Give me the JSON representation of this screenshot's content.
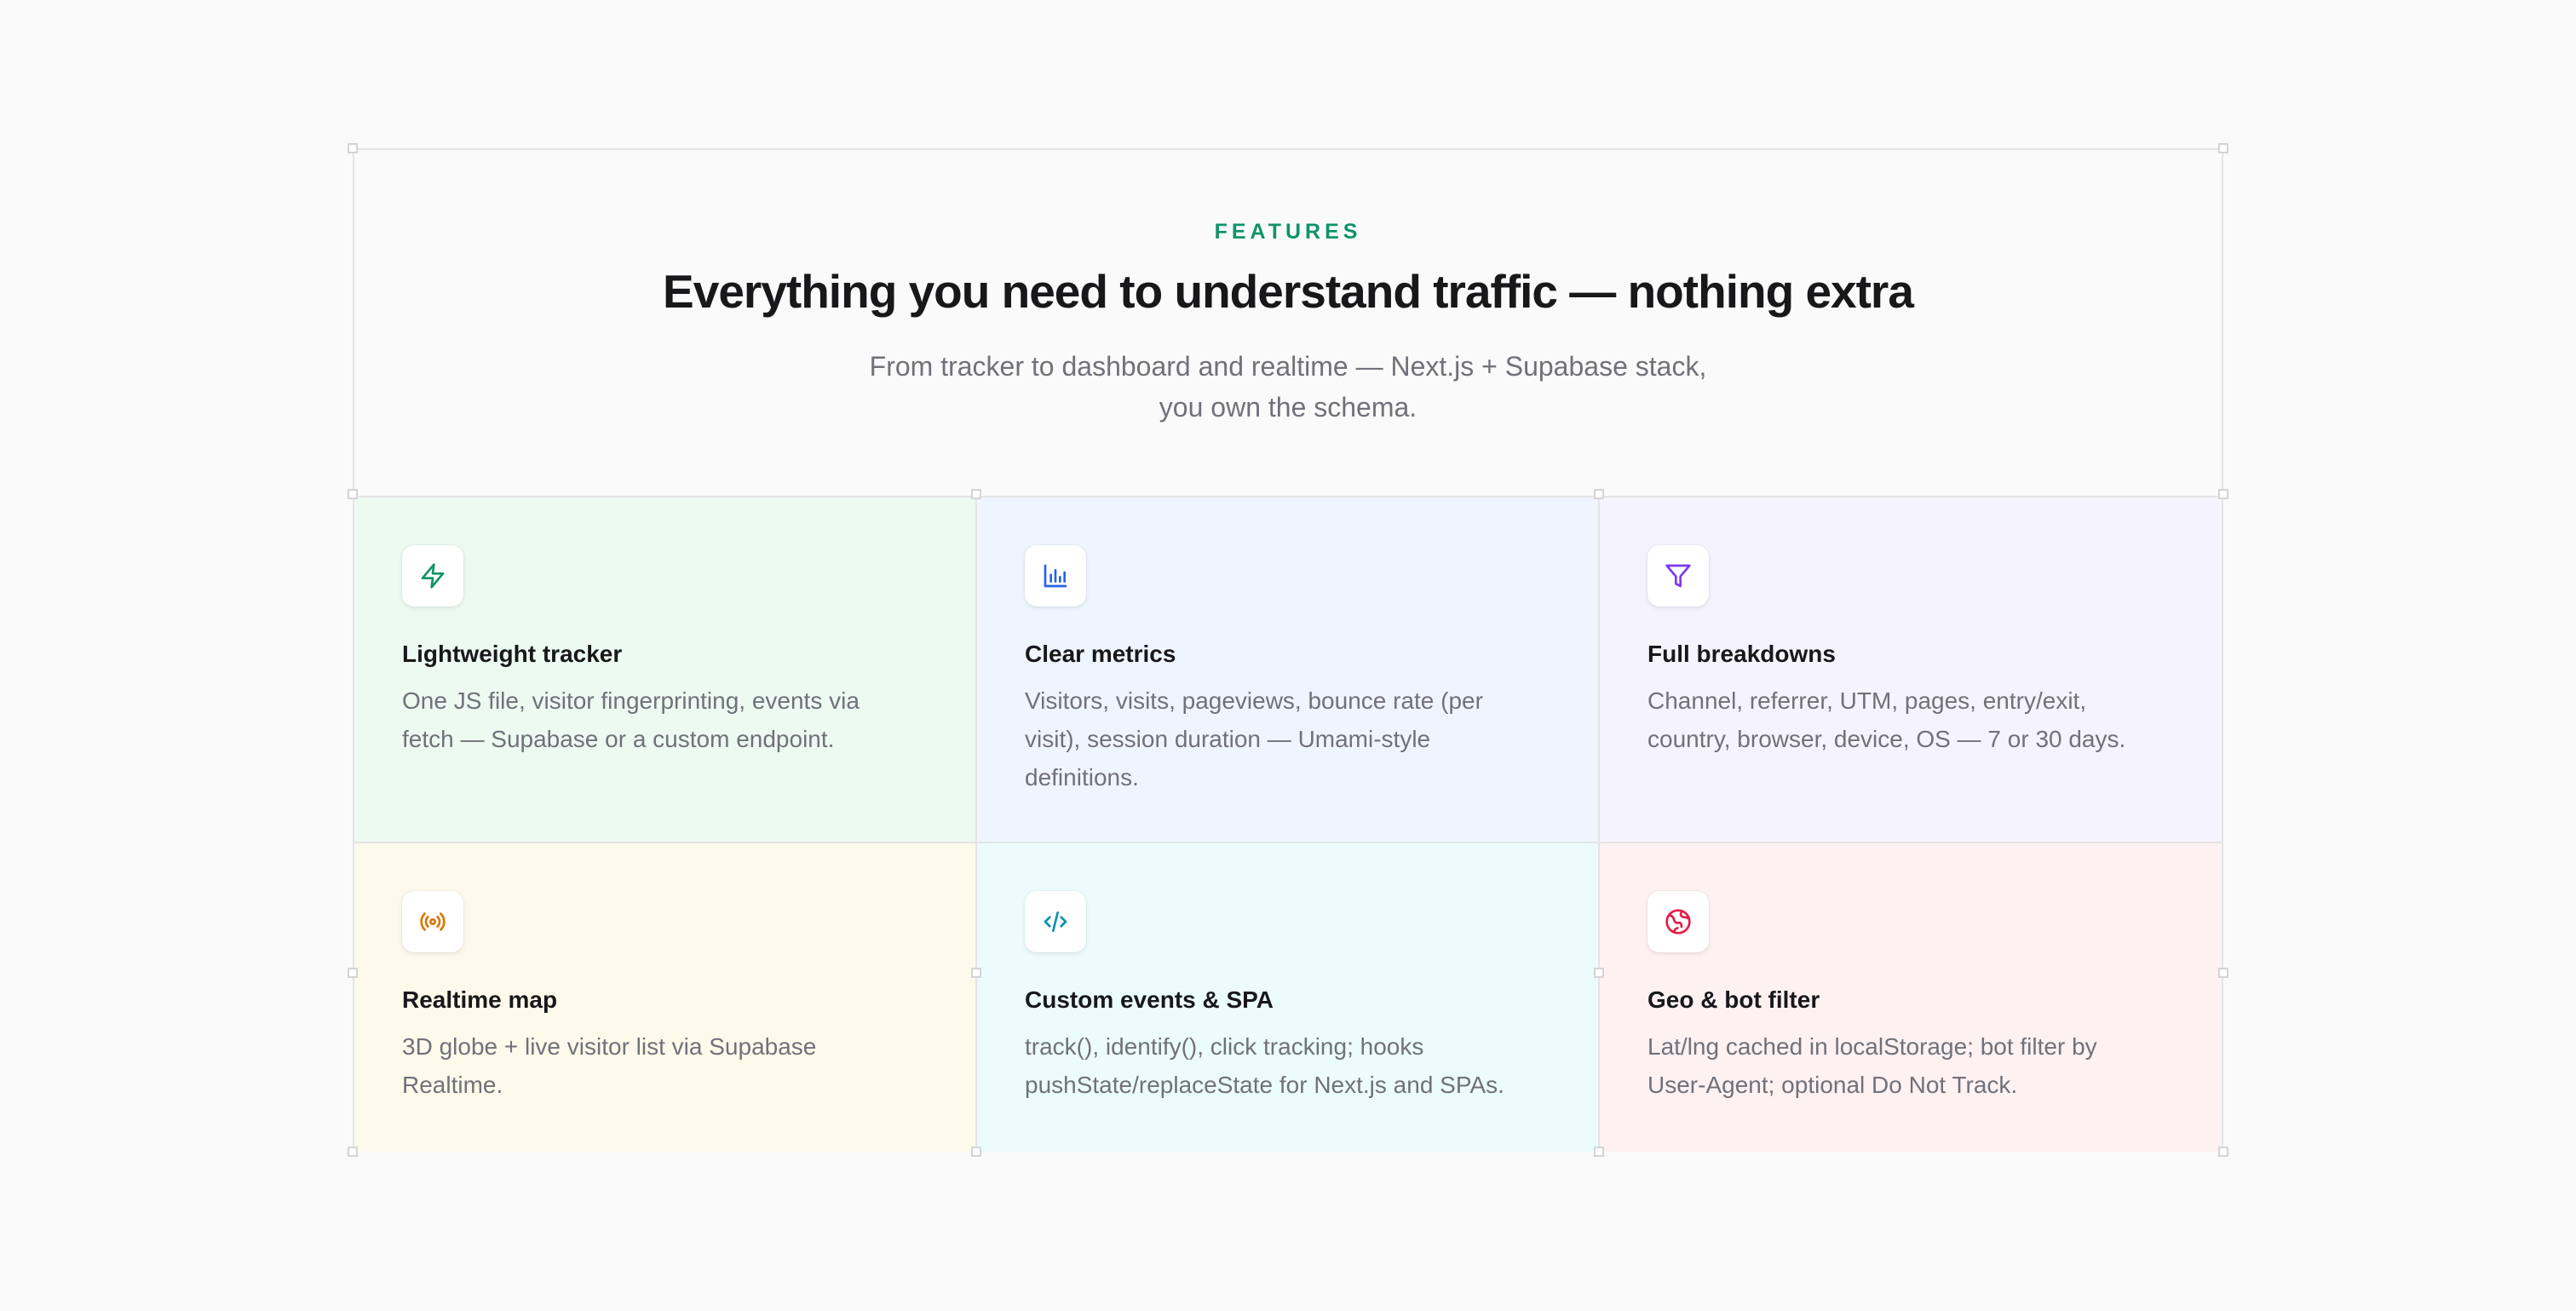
{
  "header": {
    "eyebrow": "FEATURES",
    "title": "Everything you need to understand traffic — nothing extra",
    "subtitle_line1": "From tracker to dashboard and realtime — Next.js + Supabase stack,",
    "subtitle_line2": "you own the schema.",
    "accent_color": "#10936a"
  },
  "features": [
    {
      "icon": "zap-icon",
      "icon_color": "#10936a",
      "bg": "#ecfaf2",
      "title": "Lightweight tracker",
      "description": "One JS file, visitor fingerprinting, events via fetch — Supabase or a custom endpoint."
    },
    {
      "icon": "bar-chart-icon",
      "icon_color": "#2563eb",
      "bg": "#eff5fe",
      "title": "Clear metrics",
      "description": "Visitors, visits, pageviews, bounce rate (per visit), session duration — Umami-style definitions."
    },
    {
      "icon": "filter-icon",
      "icon_color": "#7c3aed",
      "bg": "#f5f4fe",
      "title": "Full breakdowns",
      "description": "Channel, referrer, UTM, pages, entry/exit, country, browser, device, OS — 7 or 30 days."
    },
    {
      "icon": "broadcast-icon",
      "icon_color": "#d97706",
      "bg": "#fdfaeb",
      "title": "Realtime map",
      "description": "3D globe + live visitor list via Supabase Realtime."
    },
    {
      "icon": "code-icon",
      "icon_color": "#0891b2",
      "bg": "#ecfcfc",
      "title": "Custom events & SPA",
      "description": "track(), identify(), click tracking; hooks pushState/replaceState for Next.js and SPAs."
    },
    {
      "icon": "globe-icon",
      "icon_color": "#e11d48",
      "bg": "#fef1f2",
      "title": "Geo & bot filter",
      "description": "Lat/lng cached in localStorage; bot filter by User-Agent; optional Do Not Track."
    }
  ]
}
